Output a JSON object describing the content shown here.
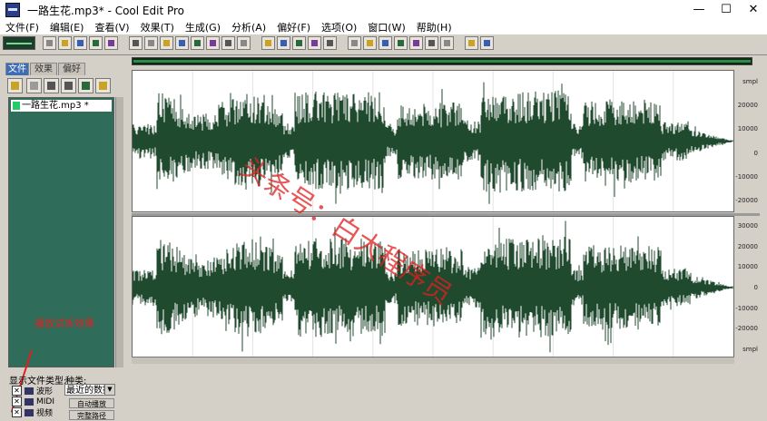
{
  "window": {
    "title": "一路生花.mp3* - Cool Edit Pro",
    "minimize": "—",
    "maximize": "☐",
    "close": "✕"
  },
  "menu": [
    "文件(F)",
    "编辑(E)",
    "查看(V)",
    "效果(T)",
    "生成(G)",
    "分析(A)",
    "偏好(F)",
    "选项(O)",
    "窗口(W)",
    "帮助(H)"
  ],
  "toolbar": {
    "icons": [
      "waveform-view-icon",
      "new-icon",
      "open-icon",
      "save-icon",
      "save-all-icon",
      "grid-icon",
      "undo-icon",
      "redo-icon",
      "cut-icon",
      "copy-icon",
      "paste-icon",
      "paste-new-icon",
      "mix-paste-icon",
      "trim-icon",
      "spectral-icon",
      "frequency-icon",
      "loop-icon",
      "cue-icon",
      "marker-icon",
      "zoom-icon",
      "zoom-in-icon",
      "zoom-out-icon",
      "play-icon",
      "record-icon",
      "stop-icon",
      "clip-icon",
      "settings-icon",
      "help-icon"
    ]
  },
  "sidebar": {
    "tabs": [
      "文件",
      "效果",
      "偏好"
    ],
    "files": [
      "一路生花.mp3 *"
    ],
    "annotation": "播放试听效果",
    "show_types_label": "显示文件类型:",
    "type_label": "种类:",
    "type_select": "最近的数据",
    "type_checks": [
      "波形",
      "MIDI",
      "视频"
    ],
    "buttons": [
      "自动播放",
      "完整路径"
    ]
  },
  "channels": [
    {
      "name": "top",
      "ticks": [
        "smpl",
        "20000",
        "10000",
        "0",
        "-10000",
        "-20000"
      ]
    },
    {
      "name": "bottom",
      "ticks": [
        "30000",
        "20000",
        "10000",
        "0",
        "-10000",
        "-20000",
        "smpl"
      ]
    }
  ],
  "watermark": "头条号：白大程序员",
  "colors": {
    "waveform": "#1f4a2e",
    "wave_background": "#ffffff",
    "annotation": "#e02020",
    "active_tab": "#3c6db5"
  }
}
